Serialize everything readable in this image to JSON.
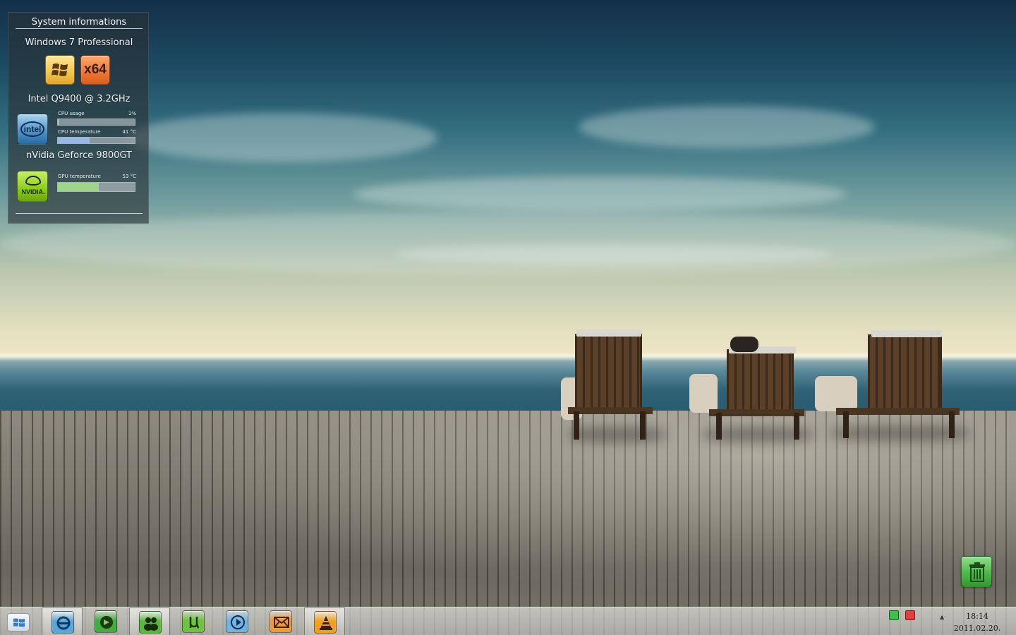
{
  "gadget": {
    "title": "System informations",
    "os_name": "Windows 7 Professional",
    "os_badges": {
      "windows_icon": "windows-logo-icon",
      "arch_label": "x64"
    },
    "cpu": {
      "name": "Intel  Q9400  @ 3.2GHz",
      "icon": "intel-logo-icon",
      "usage_label": "CPU usage",
      "usage_value": "1%",
      "usage_fraction": 0.01,
      "temp_label": "CPU temperature",
      "temp_value": "41 °C",
      "temp_fraction": 0.41,
      "temp_color": "#9bb7e8"
    },
    "gpu": {
      "name": "nVidia Geforce 9800GT",
      "icon": "nvidia-logo-icon",
      "logo_text": "NVIDIA.",
      "temp_label": "GPU temperature",
      "temp_value": "53 °C",
      "temp_fraction": 0.53,
      "temp_color": "#9fd58a"
    }
  },
  "desktop": {
    "recycle_bin_icon": "recycle-bin-icon"
  },
  "taskbar": {
    "start_icon": "windows-start-icon",
    "items": [
      {
        "name": "internet-explorer",
        "icon": "internet-explorer-icon",
        "color": "#5aa8d8",
        "active": true
      },
      {
        "name": "media-center",
        "icon": "media-center-icon",
        "color": "#3fae3a",
        "active": false
      },
      {
        "name": "messenger",
        "icon": "messenger-icon",
        "color": "#56b93a",
        "active": true
      },
      {
        "name": "utorrent",
        "icon": "utorrent-icon",
        "color": "#6ec23c",
        "active": false
      },
      {
        "name": "media-player",
        "icon": "media-player-icon",
        "color": "#6fb4e2",
        "active": false
      },
      {
        "name": "mail",
        "icon": "mail-icon",
        "color": "#ee9a3a",
        "active": false
      },
      {
        "name": "vlc",
        "icon": "vlc-icon",
        "color": "#f0a020",
        "active": true
      }
    ],
    "tray": {
      "icons": [
        {
          "name": "network-status-icon",
          "color": "#3cc04a"
        },
        {
          "name": "power-status-icon",
          "color": "#e04040"
        }
      ],
      "show_hidden_icon": "tray-arrow-icon",
      "time": "18:14",
      "date": "2011.02.20."
    }
  }
}
